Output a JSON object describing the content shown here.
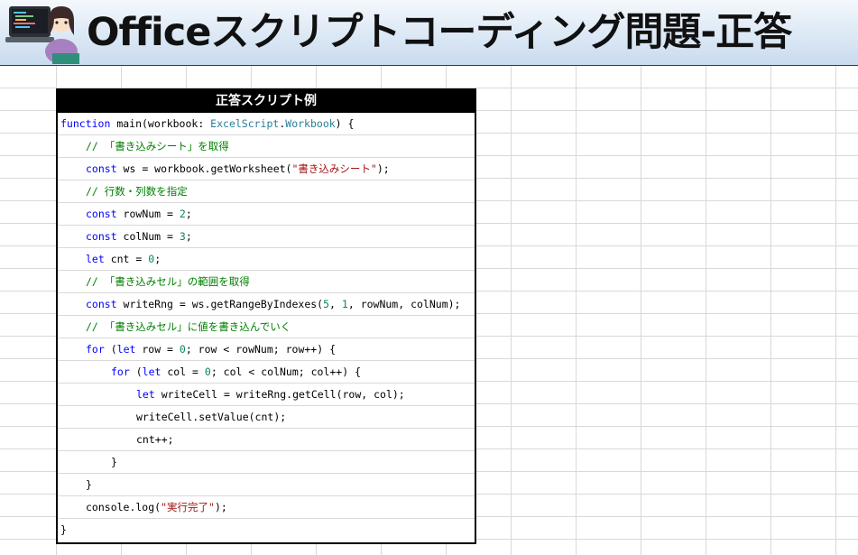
{
  "banner": {
    "title": "Officeスクリプトコーディング問題-正答"
  },
  "panel": {
    "header": "正答スクリプト例"
  },
  "colors": {
    "keyword": "#0000ff",
    "type": "#267f99",
    "string": "#a31515",
    "comment": "#008000",
    "number": "#098658",
    "text": "#000000"
  },
  "code_lines": [
    {
      "indent": 0,
      "tokens": [
        [
          "kw",
          "function"
        ],
        [
          "tx",
          " main(workbook: "
        ],
        [
          "ty",
          "ExcelScript"
        ],
        [
          "tx",
          "."
        ],
        [
          "ty",
          "Workbook"
        ],
        [
          "tx",
          ") {"
        ]
      ]
    },
    {
      "indent": 1,
      "tokens": [
        [
          "cm",
          "// 「書き込みシート」を取得"
        ]
      ]
    },
    {
      "indent": 1,
      "tokens": [
        [
          "kw",
          "const"
        ],
        [
          "tx",
          " ws = workbook.getWorksheet("
        ],
        [
          "st",
          "\"書き込みシート\""
        ],
        [
          "tx",
          ");"
        ]
      ]
    },
    {
      "indent": 1,
      "tokens": [
        [
          "cm",
          "// 行数・列数を指定"
        ]
      ]
    },
    {
      "indent": 1,
      "tokens": [
        [
          "kw",
          "const"
        ],
        [
          "tx",
          " rowNum = "
        ],
        [
          "nu",
          "2"
        ],
        [
          "tx",
          ";"
        ]
      ]
    },
    {
      "indent": 1,
      "tokens": [
        [
          "kw",
          "const"
        ],
        [
          "tx",
          " colNum = "
        ],
        [
          "nu",
          "3"
        ],
        [
          "tx",
          ";"
        ]
      ]
    },
    {
      "indent": 1,
      "tokens": [
        [
          "kw",
          "let"
        ],
        [
          "tx",
          " cnt = "
        ],
        [
          "nu",
          "0"
        ],
        [
          "tx",
          ";"
        ]
      ]
    },
    {
      "indent": 1,
      "tokens": [
        [
          "cm",
          "// 「書き込みセル」の範囲を取得"
        ]
      ]
    },
    {
      "indent": 1,
      "tokens": [
        [
          "kw",
          "const"
        ],
        [
          "tx",
          " writeRng = ws.getRangeByIndexes("
        ],
        [
          "nu",
          "5"
        ],
        [
          "tx",
          ", "
        ],
        [
          "nu",
          "1"
        ],
        [
          "tx",
          ", rowNum, colNum);"
        ]
      ]
    },
    {
      "indent": 1,
      "tokens": [
        [
          "cm",
          "// 「書き込みセル」に値を書き込んでいく"
        ]
      ]
    },
    {
      "indent": 1,
      "tokens": [
        [
          "kw",
          "for"
        ],
        [
          "tx",
          " ("
        ],
        [
          "kw",
          "let"
        ],
        [
          "tx",
          " row = "
        ],
        [
          "nu",
          "0"
        ],
        [
          "tx",
          "; row < rowNum; row++) {"
        ]
      ]
    },
    {
      "indent": 2,
      "tokens": [
        [
          "kw",
          "for"
        ],
        [
          "tx",
          " ("
        ],
        [
          "kw",
          "let"
        ],
        [
          "tx",
          " col = "
        ],
        [
          "nu",
          "0"
        ],
        [
          "tx",
          "; col < colNum; col++) {"
        ]
      ]
    },
    {
      "indent": 3,
      "tokens": [
        [
          "kw",
          "let"
        ],
        [
          "tx",
          " writeCell = writeRng.getCell(row, col);"
        ]
      ]
    },
    {
      "indent": 3,
      "tokens": [
        [
          "tx",
          "writeCell.setValue(cnt);"
        ]
      ]
    },
    {
      "indent": 3,
      "tokens": [
        [
          "tx",
          "cnt++;"
        ]
      ]
    },
    {
      "indent": 2,
      "tokens": [
        [
          "tx",
          "}"
        ]
      ]
    },
    {
      "indent": 1,
      "tokens": [
        [
          "tx",
          "}"
        ]
      ]
    },
    {
      "indent": 1,
      "tokens": [
        [
          "tx",
          "console.log("
        ],
        [
          "st",
          "\"実行完了\""
        ],
        [
          "tx",
          ");"
        ]
      ]
    },
    {
      "indent": 0,
      "tokens": [
        [
          "tx",
          "}"
        ]
      ]
    }
  ]
}
